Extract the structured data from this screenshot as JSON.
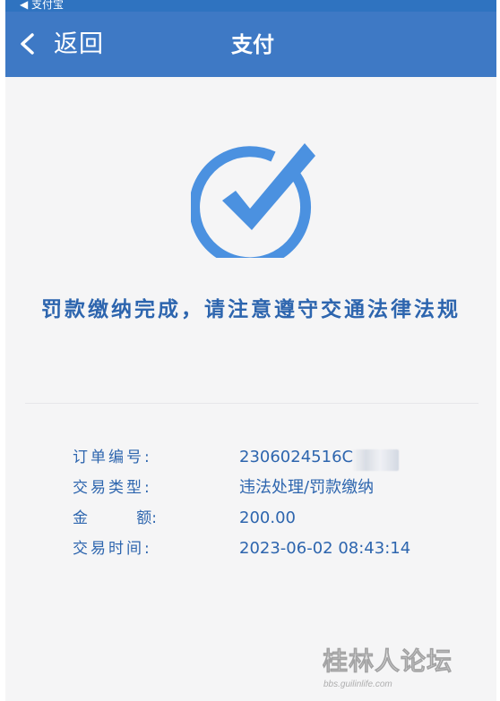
{
  "status_bar": {
    "back_app": "◀ 支付宝"
  },
  "nav": {
    "back_label": "返回",
    "title": "支付",
    "back_icon": "chevron-left-icon"
  },
  "success": {
    "icon": "check-circle-icon",
    "message": "罚款缴纳完成，请注意遵守交通法律法规"
  },
  "details": {
    "order_number": {
      "label": "订单编号:",
      "value": "2306024516C"
    },
    "transaction_type": {
      "label": "交易类型:",
      "value": "违法处理/罚款缴纳"
    },
    "amount": {
      "label_left": "金",
      "label_right": "额:",
      "value": "200.00"
    },
    "transaction_time": {
      "label": "交易时间:",
      "value": "2023-06-02 08:43:14"
    }
  },
  "watermark": {
    "text": "桂林人论坛",
    "sub_text": "bbs.guilinlife.com"
  },
  "colors": {
    "nav_blue": "#3e79c5",
    "text_blue": "#2d65ae",
    "icon_blue": "#4b91e0",
    "background": "#f5f5f6"
  }
}
